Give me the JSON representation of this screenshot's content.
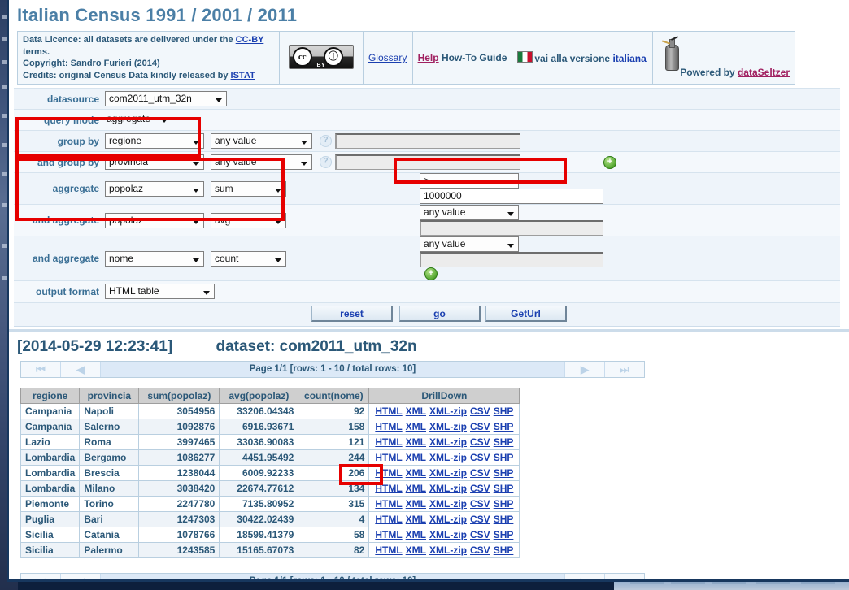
{
  "header": {
    "title": "Italian Census 1991 / 2001 / 2011",
    "licence_line1_pre": "Data Licence: all datasets are delivered under the ",
    "licence_link": "CC-BY",
    "licence_line1_post": " terms.",
    "copyright": "Copyright: Sandro Furieri (2014)",
    "credits_pre": "Credits: original Census Data kindly released by ",
    "credits_link": "ISTAT",
    "cc_mark": "cc",
    "cc_by_mark": "ⓘ",
    "cc_by_label": "BY",
    "glossary": "Glossary",
    "help": "Help",
    "howto": "How-To Guide",
    "lang_text": "vai alla versione",
    "lang_link": "italiana",
    "powered_by": "Powered by",
    "powered_link": "dataSeltzer"
  },
  "form": {
    "datasource_label": "datasource",
    "datasource_value": "com2011_utm_32n",
    "querymode_label": "query mode",
    "querymode_value": "aggregate",
    "groupby_label": "group by",
    "groupby_value": "regione",
    "groupby_filter": "any value",
    "groupby_text": "",
    "groupby2_label": "and group by",
    "groupby2_value": "provincia",
    "groupby2_filter": "any value",
    "groupby2_text": "",
    "agg1_label": "aggregate",
    "agg1_field": "popolaz",
    "agg1_func": "sum",
    "agg1_op": ">",
    "agg1_value": "1000000",
    "agg2_label": "and aggregate",
    "agg2_field": "popolaz",
    "agg2_func": "avg",
    "agg2_op": "any value",
    "agg2_value": "",
    "agg3_label": "and aggregate",
    "agg3_field": "nome",
    "agg3_func": "count",
    "agg3_op": "any value",
    "agg3_value": "",
    "output_label": "output format",
    "output_value": "HTML table",
    "help_icon": "?",
    "plus_icon": "+",
    "buttons": {
      "reset": "reset",
      "go": "go",
      "geturl": "GetUrl"
    }
  },
  "result": {
    "timestamp": "[2014-05-29 12:23:41]",
    "dataset_label": "dataset: com2011_utm_32n",
    "pager_text": "Page 1/1 [rows: 1 - 10 / total rows: 10]",
    "pager_first": "⏮",
    "pager_prev": "◀",
    "pager_next": "▶",
    "pager_last": "⏭",
    "columns": [
      "regione",
      "provincia",
      "sum(popolaz)",
      "avg(popolaz)",
      "count(nome)",
      "DrillDown"
    ],
    "drilldown_links": [
      "HTML",
      "XML",
      "XML-zip",
      "CSV",
      "SHP"
    ],
    "rows": [
      {
        "regione": "Campania",
        "provincia": "Napoli",
        "sum": "3054956",
        "avg": "33206.04348",
        "count": "92"
      },
      {
        "regione": "Campania",
        "provincia": "Salerno",
        "sum": "1092876",
        "avg": "6916.93671",
        "count": "158"
      },
      {
        "regione": "Lazio",
        "provincia": "Roma",
        "sum": "3997465",
        "avg": "33036.90083",
        "count": "121"
      },
      {
        "regione": "Lombardia",
        "provincia": "Bergamo",
        "sum": "1086277",
        "avg": "4451.95492",
        "count": "244"
      },
      {
        "regione": "Lombardia",
        "provincia": "Brescia",
        "sum": "1238044",
        "avg": "6009.92233",
        "count": "206"
      },
      {
        "regione": "Lombardia",
        "provincia": "Milano",
        "sum": "3038420",
        "avg": "22674.77612",
        "count": "134"
      },
      {
        "regione": "Piemonte",
        "provincia": "Torino",
        "sum": "2247780",
        "avg": "7135.80952",
        "count": "315"
      },
      {
        "regione": "Puglia",
        "provincia": "Bari",
        "sum": "1247303",
        "avg": "30422.02439",
        "count": "4"
      },
      {
        "regione": "Sicilia",
        "provincia": "Catania",
        "sum": "1078766",
        "avg": "18599.41379",
        "count": "58"
      },
      {
        "regione": "Sicilia",
        "provincia": "Palermo",
        "sum": "1243585",
        "avg": "15165.67073",
        "count": "82"
      }
    ]
  },
  "colors": {
    "annotation": "#e60000",
    "title": "#4b7fa6",
    "link": "#1a3fb0"
  }
}
